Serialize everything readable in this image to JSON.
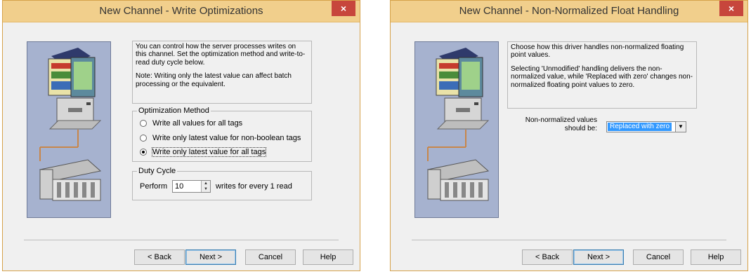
{
  "dialog1": {
    "title": "New Channel - Write Optimizations",
    "close_glyph": "×",
    "description_p1": "You can control how the server processes writes on this channel.  Set the optimization method and write-to-read duty cycle below.",
    "description_p2": "Note:  Writing only the latest value can affect batch processing or the equivalent.",
    "optimization": {
      "legend": "Optimization Method",
      "options": [
        {
          "label": "Write all values for all tags",
          "checked": false
        },
        {
          "label": "Write only latest value for non-boolean tags",
          "checked": false
        },
        {
          "label": "Write only latest value for all tags",
          "checked": true
        }
      ]
    },
    "duty_cycle": {
      "legend": "Duty Cycle",
      "perform_label": "Perform",
      "value": "10",
      "suffix": "writes for every 1 read"
    },
    "buttons": {
      "back": "< Back",
      "next": "Next >",
      "cancel": "Cancel",
      "help": "Help"
    }
  },
  "dialog2": {
    "title": "New Channel - Non-Normalized Float Handling",
    "close_glyph": "×",
    "description_p1": "Choose how this driver handles non-normalized floating point values.",
    "description_p2": "Selecting 'Unmodified' handling delivers the non-normalized value, while 'Replaced with zero' changes non-normalized floating point values to zero.",
    "field_label_1": "Non-normalized values",
    "field_label_2": "should be:",
    "select_value": "Replaced with zero",
    "buttons": {
      "back": "< Back",
      "next": "Next >",
      "cancel": "Cancel",
      "help": "Help"
    }
  },
  "icons": {
    "wizard_art": "computer-and-plc-hardware-illustration",
    "close": "close-icon",
    "dropdown": "chevron-down-icon",
    "spin": "spin-up-down-icon"
  },
  "colors": {
    "title_bar": "#f1cf8c",
    "close_button": "#c7463c",
    "selection": "#3399ff",
    "art_background": "#a6b2cf"
  }
}
